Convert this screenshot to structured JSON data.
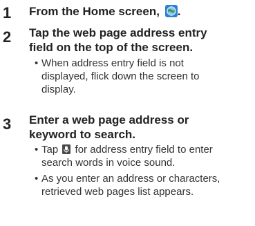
{
  "steps": [
    {
      "number": "1",
      "title_before_icon": "From the Home screen,",
      "title_after_icon": ".",
      "icon": "browser-globe-icon"
    },
    {
      "number": "2",
      "title_lines": [
        "Tap the web page address entry",
        "field on the top of the screen."
      ],
      "notes": [
        {
          "bullet": "•",
          "lines": [
            "When address entry field is not",
            "displayed, flick down the screen to",
            "display."
          ]
        }
      ]
    },
    {
      "number": "3",
      "title_lines": [
        "Enter a web page address or",
        "keyword to search."
      ],
      "notes": [
        {
          "bullet": "•",
          "line1_before_icon": "Tap",
          "line1_after_icon": "for address entry field to enter",
          "line2": "search words in voice sound.",
          "icon": "microphone-icon"
        },
        {
          "bullet": "•",
          "lines": [
            "As you enter an address or characters,",
            "retrieved web pages list appears."
          ]
        }
      ]
    }
  ],
  "colors": {
    "text": "#222222",
    "note_text": "#333333",
    "globe_blue": "#2f7fd3",
    "globe_light": "#8cc5f2",
    "mic_dark": "#4a4a4a"
  }
}
